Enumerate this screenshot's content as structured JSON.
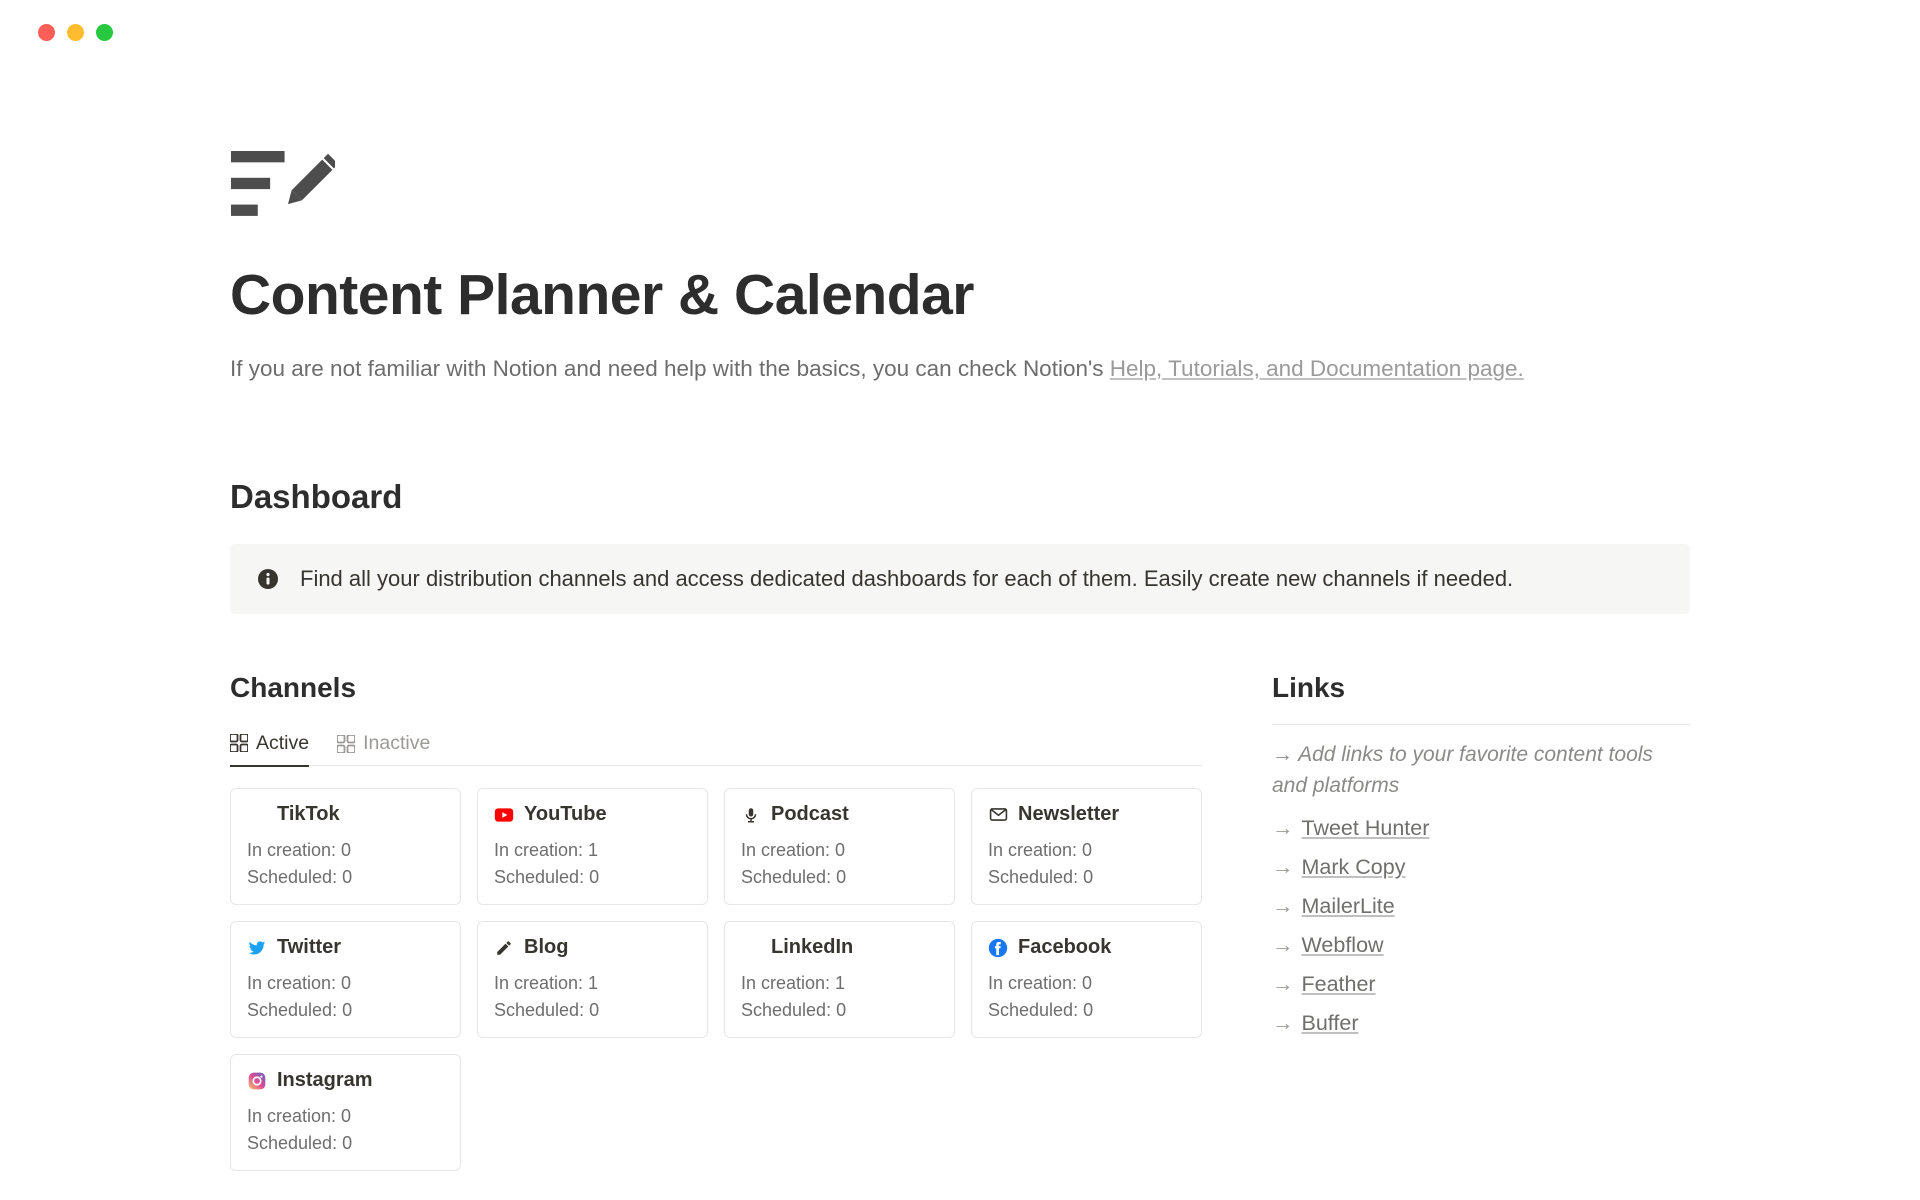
{
  "page": {
    "title": "Content Planner & Calendar",
    "intro_text": "If you are not familiar with Notion and need help with the basics, you can check Notion's ",
    "intro_link": "Help, Tutorials, and Documentation page."
  },
  "dashboard": {
    "title": "Dashboard",
    "callout": "Find all your distribution channels and access dedicated dashboards for each of them. Easily create new channels if needed."
  },
  "channels": {
    "title": "Channels",
    "tabs": {
      "active": "Active",
      "inactive": "Inactive"
    },
    "cards": [
      {
        "icon": "tiktok",
        "name": "TikTok",
        "in_creation": "In creation: 0",
        "scheduled": "Scheduled: 0"
      },
      {
        "icon": "youtube",
        "name": "YouTube",
        "in_creation": "In creation: 1",
        "scheduled": "Scheduled: 0"
      },
      {
        "icon": "podcast",
        "name": "Podcast",
        "in_creation": "In creation: 0",
        "scheduled": "Scheduled: 0"
      },
      {
        "icon": "newsletter",
        "name": "Newsletter",
        "in_creation": "In creation: 0",
        "scheduled": "Scheduled: 0"
      },
      {
        "icon": "twitter",
        "name": "Twitter",
        "in_creation": "In creation: 0",
        "scheduled": "Scheduled: 0"
      },
      {
        "icon": "blog",
        "name": "Blog",
        "in_creation": "In creation: 1",
        "scheduled": "Scheduled: 0"
      },
      {
        "icon": "linkedin",
        "name": "LinkedIn",
        "in_creation": "In creation: 1",
        "scheduled": "Scheduled: 0"
      },
      {
        "icon": "facebook",
        "name": "Facebook",
        "in_creation": "In creation: 0",
        "scheduled": "Scheduled: 0"
      },
      {
        "icon": "instagram",
        "name": "Instagram",
        "in_creation": "In creation: 0",
        "scheduled": "Scheduled: 0"
      }
    ]
  },
  "links": {
    "title": "Links",
    "helper_arrow": "→",
    "helper": "Add links to your favorite content tools and platforms",
    "items": [
      "Tweet Hunter",
      "Mark Copy",
      "MailerLite",
      "Webflow",
      "Feather",
      "Buffer"
    ]
  }
}
